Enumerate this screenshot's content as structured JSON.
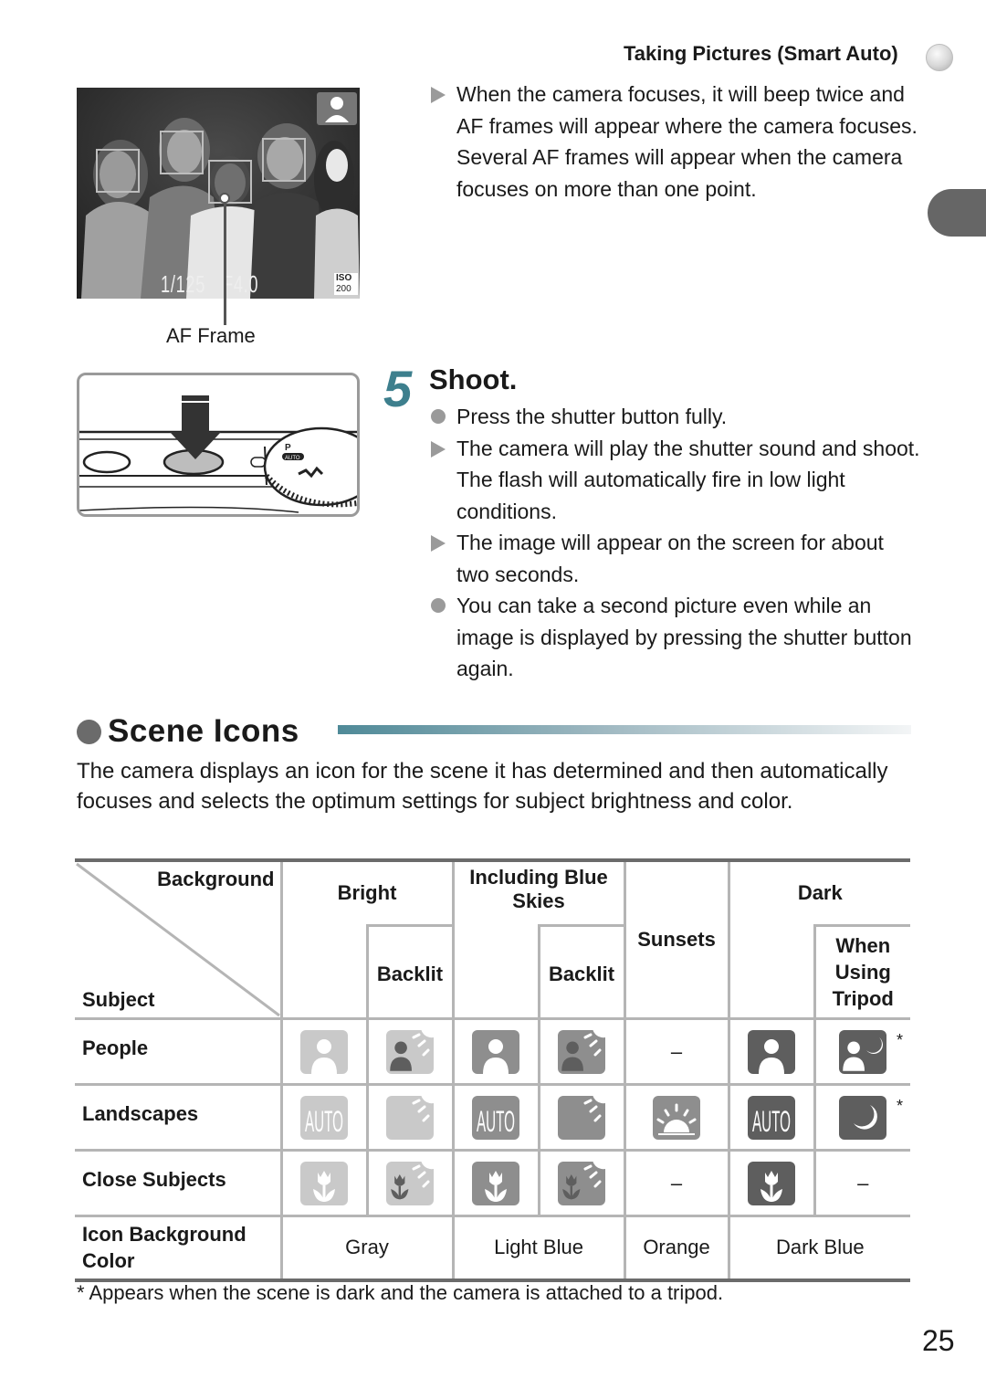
{
  "header": {
    "running_head": "Taking Pictures (Smart Auto)"
  },
  "lcd_screen": {
    "shutter_speed": "1/125",
    "aperture": "F4.0",
    "iso_label": "ISO",
    "iso_value": "200",
    "callout_label": "AF Frame"
  },
  "focus_notes": [
    {
      "bullet": "triangle",
      "text": "When the camera focuses, it will beep twice and AF frames will appear where the camera focuses."
    },
    {
      "bullet": "none",
      "text": "Several AF frames will appear when the camera focuses on more than one point."
    }
  ],
  "step": {
    "number": "5",
    "title": "Shoot.",
    "items": [
      {
        "bullet": "circle",
        "text": "Press the shutter button fully."
      },
      {
        "bullet": "triangle",
        "text": "The camera will play the shutter sound and shoot. The flash will automatically fire in low light conditions."
      },
      {
        "bullet": "triangle",
        "text": "The image will appear on the screen for about two seconds."
      },
      {
        "bullet": "circle",
        "text": "You can take a second picture even while an image is displayed by pressing the shutter button again."
      }
    ]
  },
  "section": {
    "title": "Scene Icons",
    "intro": "The camera displays an icon for the scene it has determined and then automatically focuses and selects the optimum settings for subject brightness and color."
  },
  "table": {
    "corner_background": "Background",
    "corner_subject": "Subject",
    "col_bright": "Bright",
    "col_blue_skies": "Including Blue Skies",
    "col_sunsets": "Sunsets",
    "col_dark": "Dark",
    "sub_backlit_1": "Backlit",
    "sub_backlit_2": "Backlit",
    "sub_tripod": "When Using Tripod",
    "rows": [
      {
        "label": "People",
        "cells": [
          {
            "icon": "portrait-icon",
            "bg": "#c9c9c9",
            "fg": "#ffffff"
          },
          {
            "icon": "portrait-backlit-icon",
            "bg": "#c9c9c9",
            "fg": "#5e5e5e"
          },
          {
            "icon": "portrait-icon",
            "bg": "#8e8e8e",
            "fg": "#ffffff"
          },
          {
            "icon": "portrait-backlit-icon",
            "bg": "#8e8e8e",
            "fg": "#5e5e5e"
          },
          {
            "text": "–"
          },
          {
            "icon": "portrait-icon",
            "bg": "#5e5e5e",
            "fg": "#ffffff"
          },
          {
            "icon": "night-portrait-icon",
            "bg": "#5e5e5e",
            "fg": "#ffffff",
            "note": "*"
          }
        ]
      },
      {
        "label": "Landscapes",
        "cells": [
          {
            "icon": "auto-icon",
            "bg": "#c9c9c9",
            "fg": "#ffffff",
            "text_in_icon": "AUTO"
          },
          {
            "icon": "backlit-icon",
            "bg": "#c9c9c9",
            "fg": "#ffffff"
          },
          {
            "icon": "auto-icon",
            "bg": "#8e8e8e",
            "fg": "#ffffff",
            "text_in_icon": "AUTO"
          },
          {
            "icon": "backlit-icon",
            "bg": "#8e8e8e",
            "fg": "#ffffff"
          },
          {
            "icon": "sunset-icon",
            "bg": "#8e8e8e",
            "fg": "#ffffff"
          },
          {
            "icon": "auto-icon",
            "bg": "#5e5e5e",
            "fg": "#ffffff",
            "text_in_icon": "AUTO"
          },
          {
            "icon": "night-scene-icon",
            "bg": "#5e5e5e",
            "fg": "#ffffff",
            "note": "*"
          }
        ]
      },
      {
        "label": "Close Subjects",
        "cells": [
          {
            "icon": "macro-icon",
            "bg": "#c9c9c9",
            "fg": "#ffffff"
          },
          {
            "icon": "macro-backlit-icon",
            "bg": "#c9c9c9",
            "fg": "#5e5e5e"
          },
          {
            "icon": "macro-icon",
            "bg": "#8e8e8e",
            "fg": "#ffffff"
          },
          {
            "icon": "macro-backlit-icon",
            "bg": "#8e8e8e",
            "fg": "#5e5e5e"
          },
          {
            "text": "–"
          },
          {
            "icon": "macro-icon",
            "bg": "#5e5e5e",
            "fg": "#ffffff"
          },
          {
            "text": "–"
          }
        ]
      }
    ],
    "bg_color_row": {
      "label": "Icon Background Color",
      "values": [
        "Gray",
        "Light Blue",
        "Orange",
        "Dark Blue"
      ]
    }
  },
  "footnote": "* Appears when the scene is dark and the camera is attached to a tripod.",
  "page_number": "25",
  "colors": {
    "accent_teal": "#3d7f8d",
    "bullet_gray": "#9a9a9a",
    "rule_dark": "#6b6b6b",
    "grid_gray": "#b5b5b5"
  }
}
